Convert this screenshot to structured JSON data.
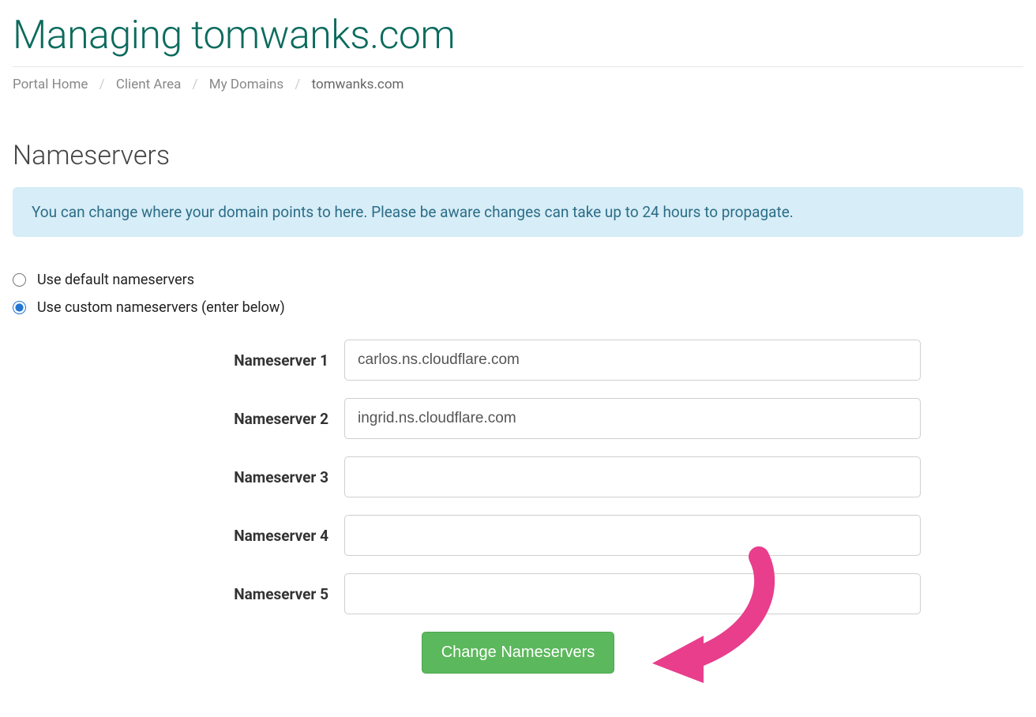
{
  "header": {
    "title": "Managing tomwanks.com"
  },
  "breadcrumb": {
    "items": [
      {
        "label": "Portal Home",
        "current": false
      },
      {
        "label": "Client Area",
        "current": false
      },
      {
        "label": "My Domains",
        "current": false
      },
      {
        "label": "tomwanks.com",
        "current": true
      }
    ]
  },
  "section": {
    "title": "Nameservers",
    "info": "You can change where your domain points to here. Please be aware changes can take up to 24 hours to propagate."
  },
  "radio": {
    "default_label": "Use default nameservers",
    "custom_label": "Use custom nameservers (enter below)",
    "selected": "custom"
  },
  "form": {
    "fields": [
      {
        "label": "Nameserver 1",
        "value": "carlos.ns.cloudflare.com"
      },
      {
        "label": "Nameserver 2",
        "value": "ingrid.ns.cloudflare.com"
      },
      {
        "label": "Nameserver 3",
        "value": ""
      },
      {
        "label": "Nameserver 4",
        "value": ""
      },
      {
        "label": "Nameserver 5",
        "value": ""
      }
    ],
    "submit_label": "Change Nameservers"
  }
}
